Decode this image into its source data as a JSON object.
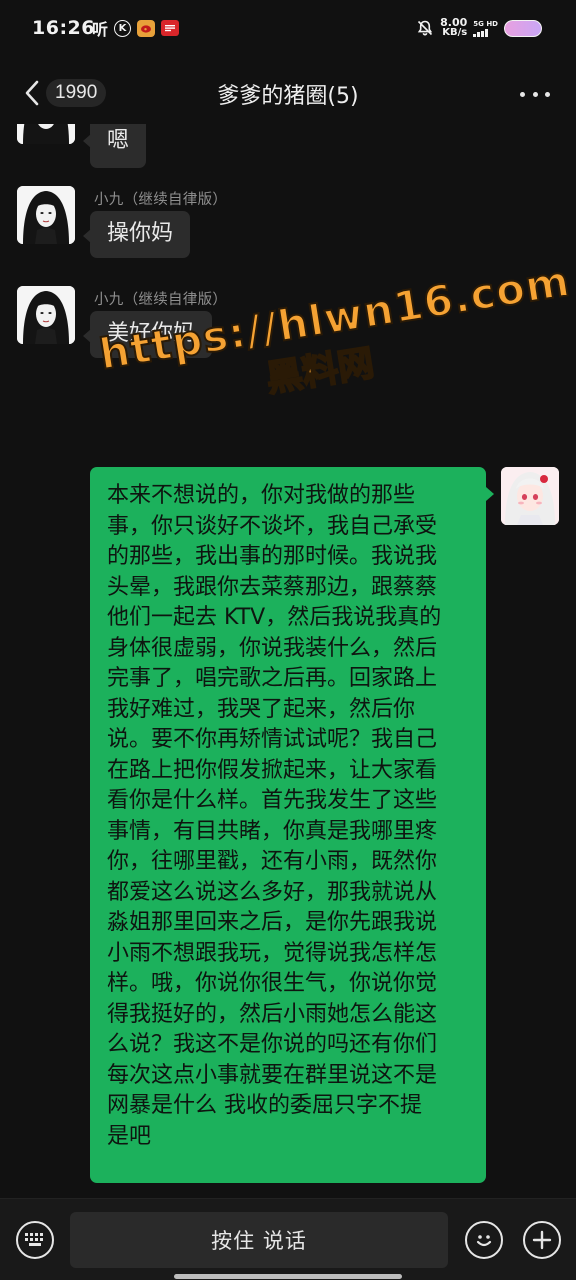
{
  "status_bar": {
    "time": "16:26",
    "left_glyph": "听",
    "k_glyph": "K",
    "speed_value": "8.00",
    "speed_unit": "KB/s",
    "network": "5G HD"
  },
  "header": {
    "unread_count": "1990",
    "title": "爹爹的猪圈(5)"
  },
  "messages": [
    {
      "sender": "",
      "text": "嗯"
    },
    {
      "sender": "小九（继续自律版）",
      "text": "操你妈"
    },
    {
      "sender": "小九（继续自律版）",
      "text": "美好你妈"
    },
    {
      "sender": "me",
      "lines": [
        "本来不想说的，你对我做的那些",
        "事，你只谈好不谈坏，我自己承受",
        "的那些，我出事的那时候。我说我",
        "头晕，我跟你去菜蔡那边，跟蔡蔡",
        "他们一起去 KTV，然后我说我真的",
        "身体很虚弱，你说我装什么，然后",
        "完事了，唱完歌之后再。回家路上",
        "我好难过，我哭了起来，然后你",
        "说。要不你再矫情试试呢？我自己",
        "在路上把你假发掀起来，让大家看",
        "看你是什么样。首先我发生了这些",
        "事情，有目共睹，你真是我哪里疼",
        "你，往哪里戳，还有小雨，既然你",
        "都爱这么说这么多好，那我就说从",
        "淼姐那里回来之后，是你先跟我说",
        "小雨不想跟我玩，觉得说我怎样怎",
        "样。哦，你说你很生气，你说你觉",
        "得我挺好的，然后小雨她怎么能这",
        "么说？我这不是你说的吗还有你们",
        "每次这点小事就要在群里说这不是",
        "网暴是什么 我收的委屈只字不提",
        "是吧"
      ]
    }
  ],
  "watermark": {
    "url": "https://hlwn16.com",
    "subtitle": "黑料网"
  },
  "input_bar": {
    "voice_label": "按住 说话"
  },
  "colors": {
    "background": "#111111",
    "outgoing_bubble": "#1cb15c",
    "incoming_bubble": "#2c2c2c",
    "watermark": "#f5a233"
  }
}
